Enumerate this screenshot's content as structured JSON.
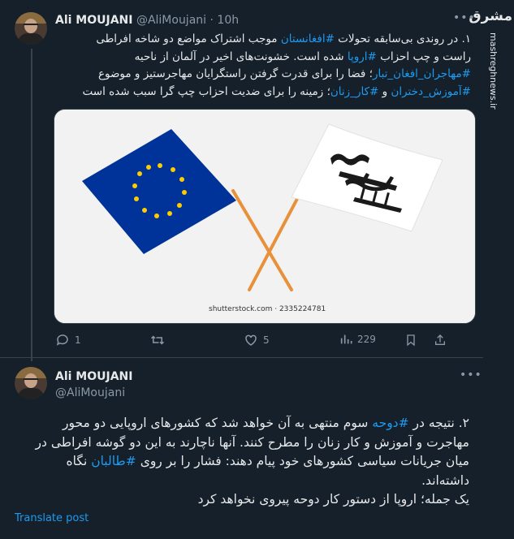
{
  "watermark": {
    "logo": "مشرق",
    "url": "mashreghnews.ir"
  },
  "tweet1": {
    "author_name": "Ali MOUJANI",
    "author_handle": "@AliMoujani",
    "separator": "·",
    "time": "10h",
    "more_icon": "more-horizontal-icon",
    "lines": [
      [
        "۱. در روندی بی‌سابقه تحولات ",
        {
          "tag": "#افغانستان"
        },
        " موجب اشتراک مواضع دو شاخه افراطی"
      ],
      [
        "راست و چپ احزاب ",
        {
          "tag": "#اروپا"
        },
        " شده است. خشونت‌های اخیر در آلمان از ناحیه"
      ],
      [
        {
          "tag": "#مهاجران_افغان_تبار"
        },
        "؛ فضا را برای قدرت گرفتن راستگرایان مهاجرستیز و موضوع"
      ],
      [
        {
          "tag": "#آموزش_دختران"
        },
        " و ",
        {
          "tag": "#کار_زنان"
        },
        "؛ زمینه را برای ضدیت احزاب چپ گرا سبب شده است"
      ]
    ],
    "media_credit": "shutterstock.com · 2335224781",
    "actions": {
      "replies": "1",
      "likes": "5",
      "views": "229"
    },
    "colors": {
      "eu_blue": "#003399",
      "eu_star": "#ffcc00",
      "pole": "#e8913a"
    }
  },
  "tweet2": {
    "author_name": "Ali MOUJANI",
    "author_handle": "@AliMoujani",
    "more_icon": "more-horizontal-icon",
    "lines": [
      [
        "۲. نتیجه در ",
        {
          "tag": "#دوحه"
        },
        " سوم منتهی به آن خواهد شد که کشورهای اروپایی دو محور"
      ],
      [
        "مهاجرت و آموزش و کار زنان را مطرح کنند. آنها ناچارند به این دو گوشه افراطی در"
      ],
      [
        "میان جریانات سیاسی کشورهای خود پیام دهند: فشار را بر روی ",
        {
          "tag": "#طالبان"
        },
        " نگاه"
      ],
      [
        "داشته‌اند."
      ],
      [
        "یک جمله؛ اروپا از دستور کار دوحه پیروی نخواهد کرد"
      ]
    ],
    "translate_label": "Translate post"
  }
}
